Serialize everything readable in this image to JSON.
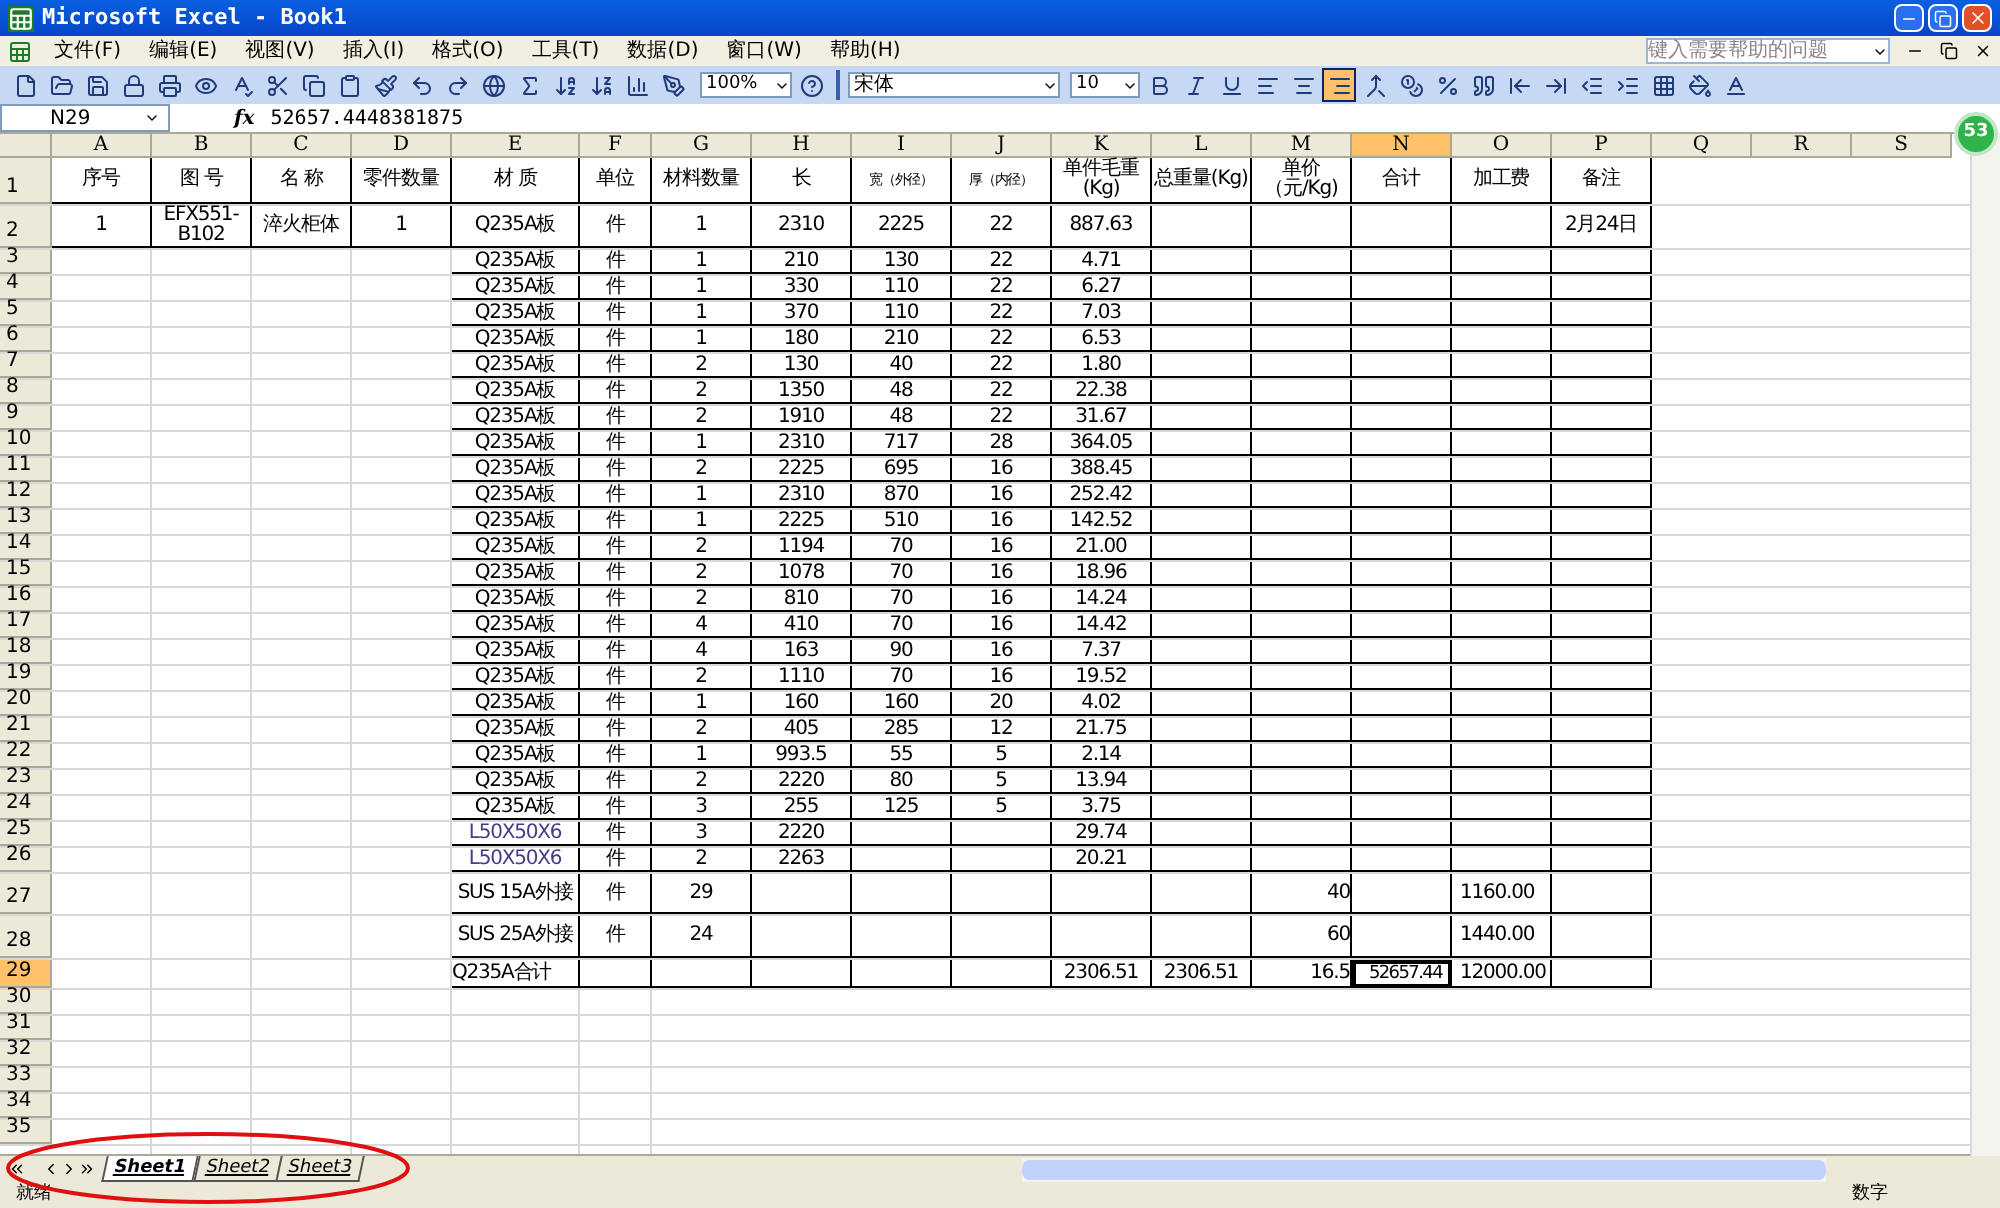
{
  "window": {
    "title": "Microsoft Excel - Book1"
  },
  "menu": [
    "文件(F)",
    "编辑(E)",
    "视图(V)",
    "插入(I)",
    "格式(O)",
    "工具(T)",
    "数据(D)",
    "窗口(W)",
    "帮助(H)"
  ],
  "help_box": {
    "placeholder": "键入需要帮助的问题"
  },
  "toolbar": {
    "zoom": "100%",
    "font": "宋体",
    "font_size": "10",
    "alignment": [
      {
        "selected": false
      },
      {
        "selected": false
      },
      {
        "selected": true
      }
    ]
  },
  "formula_bar": {
    "name_box": "N29",
    "fx": "fx",
    "value": "52657.4448381875"
  },
  "badge": "53",
  "columns": [
    {
      "label": "A",
      "selected": false
    },
    {
      "label": "B",
      "selected": false
    },
    {
      "label": "C",
      "selected": false
    },
    {
      "label": "D",
      "selected": false
    },
    {
      "label": "E",
      "selected": false
    },
    {
      "label": "F",
      "selected": false
    },
    {
      "label": "G",
      "selected": false
    },
    {
      "label": "H",
      "selected": false
    },
    {
      "label": "I",
      "selected": false
    },
    {
      "label": "J",
      "selected": false
    },
    {
      "label": "K",
      "selected": false
    },
    {
      "label": "L",
      "selected": false
    },
    {
      "label": "M",
      "selected": false
    },
    {
      "label": "N",
      "selected": true
    },
    {
      "label": "O",
      "selected": false
    },
    {
      "label": "P",
      "selected": false
    },
    {
      "label": "Q",
      "selected": false
    },
    {
      "label": "R",
      "selected": false
    },
    {
      "label": "S",
      "selected": false
    }
  ],
  "rows": [
    {
      "number": "1",
      "selected": false,
      "cells": {
        "A": "序号",
        "B": "图 号",
        "C": "名 称",
        "D": "零件数量",
        "E": "材 质",
        "F": "单位",
        "G": "材料数量",
        "H": "长",
        "I": "宽（外径）",
        "J": "厚（内径）",
        "K": "单件毛重(Kg)",
        "L": "总重量(Kg)",
        "M": "单价（元/Kg)",
        "N": "合计",
        "O": "加工费",
        "P": "备注"
      }
    },
    {
      "number": "2",
      "selected": false,
      "cells": {
        "A": "1",
        "B": "EFX551-B102",
        "C": "淬火柜体",
        "D": "1",
        "E": "Q235A板",
        "F": "件",
        "G": "1",
        "H": "2310",
        "I": "2225",
        "J": "22",
        "K": "887.63",
        "P": "2月24日"
      }
    },
    {
      "number": "3",
      "selected": false,
      "cells": {
        "E": "Q235A板",
        "F": "件",
        "G": "1",
        "H": "210",
        "I": "130",
        "J": "22",
        "K": "4.71"
      }
    },
    {
      "number": "4",
      "selected": false,
      "cells": {
        "E": "Q235A板",
        "F": "件",
        "G": "1",
        "H": "330",
        "I": "110",
        "J": "22",
        "K": "6.27"
      }
    },
    {
      "number": "5",
      "selected": false,
      "cells": {
        "E": "Q235A板",
        "F": "件",
        "G": "1",
        "H": "370",
        "I": "110",
        "J": "22",
        "K": "7.03"
      }
    },
    {
      "number": "6",
      "selected": false,
      "cells": {
        "E": "Q235A板",
        "F": "件",
        "G": "1",
        "H": "180",
        "I": "210",
        "J": "22",
        "K": "6.53"
      }
    },
    {
      "number": "7",
      "selected": false,
      "cells": {
        "E": "Q235A板",
        "F": "件",
        "G": "2",
        "H": "130",
        "I": "40",
        "J": "22",
        "K": "1.80"
      }
    },
    {
      "number": "8",
      "selected": false,
      "cells": {
        "E": "Q235A板",
        "F": "件",
        "G": "2",
        "H": "1350",
        "I": "48",
        "J": "22",
        "K": "22.38"
      }
    },
    {
      "number": "9",
      "selected": false,
      "cells": {
        "E": "Q235A板",
        "F": "件",
        "G": "2",
        "H": "1910",
        "I": "48",
        "J": "22",
        "K": "31.67"
      }
    },
    {
      "number": "10",
      "selected": false,
      "cells": {
        "E": "Q235A板",
        "F": "件",
        "G": "1",
        "H": "2310",
        "I": "717",
        "J": "28",
        "K": "364.05"
      }
    },
    {
      "number": "11",
      "selected": false,
      "cells": {
        "E": "Q235A板",
        "F": "件",
        "G": "2",
        "H": "2225",
        "I": "695",
        "J": "16",
        "K": "388.45"
      }
    },
    {
      "number": "12",
      "selected": false,
      "cells": {
        "E": "Q235A板",
        "F": "件",
        "G": "1",
        "H": "2310",
        "I": "870",
        "J": "16",
        "K": "252.42"
      }
    },
    {
      "number": "13",
      "selected": false,
      "cells": {
        "E": "Q235A板",
        "F": "件",
        "G": "1",
        "H": "2225",
        "I": "510",
        "J": "16",
        "K": "142.52"
      }
    },
    {
      "number": "14",
      "selected": false,
      "cells": {
        "E": "Q235A板",
        "F": "件",
        "G": "2",
        "H": "1194",
        "I": "70",
        "J": "16",
        "K": "21.00"
      }
    },
    {
      "number": "15",
      "selected": false,
      "cells": {
        "E": "Q235A板",
        "F": "件",
        "G": "2",
        "H": "1078",
        "I": "70",
        "J": "16",
        "K": "18.96"
      }
    },
    {
      "number": "16",
      "selected": false,
      "cells": {
        "E": "Q235A板",
        "F": "件",
        "G": "2",
        "H": "810",
        "I": "70",
        "J": "16",
        "K": "14.24"
      }
    },
    {
      "number": "17",
      "selected": false,
      "cells": {
        "E": "Q235A板",
        "F": "件",
        "G": "4",
        "H": "410",
        "I": "70",
        "J": "16",
        "K": "14.42"
      }
    },
    {
      "number": "18",
      "selected": false,
      "cells": {
        "E": "Q235A板",
        "F": "件",
        "G": "4",
        "H": "163",
        "I": "90",
        "J": "16",
        "K": "7.37"
      }
    },
    {
      "number": "19",
      "selected": false,
      "cells": {
        "E": "Q235A板",
        "F": "件",
        "G": "2",
        "H": "1110",
        "I": "70",
        "J": "16",
        "K": "19.52"
      }
    },
    {
      "number": "20",
      "selected": false,
      "cells": {
        "E": "Q235A板",
        "F": "件",
        "G": "1",
        "H": "160",
        "I": "160",
        "J": "20",
        "K": "4.02"
      }
    },
    {
      "number": "21",
      "selected": false,
      "cells": {
        "E": "Q235A板",
        "F": "件",
        "G": "2",
        "H": "405",
        "I": "285",
        "J": "12",
        "K": "21.75"
      }
    },
    {
      "number": "22",
      "selected": false,
      "cells": {
        "E": "Q235A板",
        "F": "件",
        "G": "1",
        "H": "993.5",
        "I": "55",
        "J": "5",
        "K": "2.14"
      }
    },
    {
      "number": "23",
      "selected": false,
      "cells": {
        "E": "Q235A板",
        "F": "件",
        "G": "2",
        "H": "2220",
        "I": "80",
        "J": "5",
        "K": "13.94"
      }
    },
    {
      "number": "24",
      "selected": false,
      "cells": {
        "E": "Q235A板",
        "F": "件",
        "G": "3",
        "H": "255",
        "I": "125",
        "J": "5",
        "K": "3.75"
      }
    },
    {
      "number": "25",
      "selected": false,
      "cells": {
        "E": "L50X50X6",
        "F": "件",
        "G": "3",
        "H": "2220",
        "K": "29.74"
      }
    },
    {
      "number": "26",
      "selected": false,
      "cells": {
        "E": "L50X50X6",
        "F": "件",
        "G": "2",
        "H": "2263",
        "K": "20.21"
      }
    },
    {
      "number": "27",
      "selected": false,
      "cells": {
        "E": "SUS 15A外接",
        "F": "件",
        "G": "29",
        "M": "40",
        "O": "1160.00"
      }
    },
    {
      "number": "28",
      "selected": false,
      "cells": {
        "E": "SUS 25A外接",
        "F": "件",
        "G": "24",
        "M": "60",
        "O": "1440.00"
      }
    },
    {
      "number": "29",
      "selected": true,
      "cells": {
        "E": "Q235A合计",
        "K": "2306.51",
        "L": "2306.51",
        "M": "16.5",
        "N": "52657.44",
        "O": "12000.00"
      }
    },
    {
      "number": "30",
      "selected": false
    },
    {
      "number": "31",
      "selected": false
    },
    {
      "number": "32",
      "selected": false
    },
    {
      "number": "33",
      "selected": false
    },
    {
      "number": "34",
      "selected": false
    },
    {
      "number": "35",
      "selected": false
    }
  ],
  "sheets": [
    {
      "label": "Sheet1",
      "selected": true
    },
    {
      "label": "Sheet2",
      "selected": false
    },
    {
      "label": "Sheet3",
      "selected": false
    }
  ],
  "status_bar": {
    "left": "就绪",
    "right": "数字"
  }
}
